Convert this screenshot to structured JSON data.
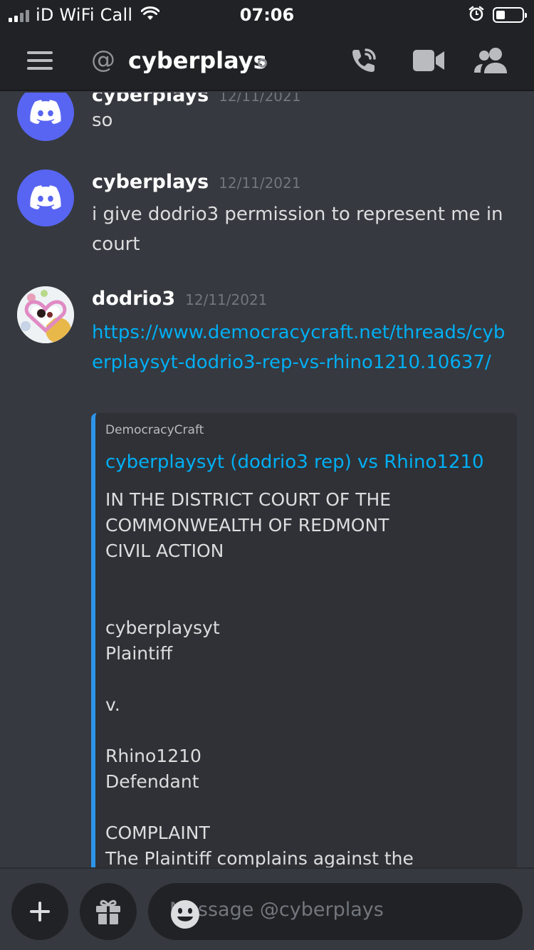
{
  "status_bar": {
    "carrier": "iD WiFi Call",
    "time": "07:06"
  },
  "header": {
    "channel_name": "cyberplays"
  },
  "messages": [
    {
      "username": "cyberplays",
      "timestamp": "12/11/2021",
      "text": "so"
    },
    {
      "username": "cyberplays",
      "timestamp": "12/11/2021",
      "text": "i give dodrio3  permission to represent me in court"
    },
    {
      "username": "dodrio3",
      "timestamp": "12/11/2021",
      "link": "https://www.democracycraft.net/threads/cyberplaysyt-dodrio3-rep-vs-rhino1210.10637/",
      "embed": {
        "provider": "DemocracyCraft",
        "title": "cyberplaysyt (dodrio3 rep) vs Rhino1210",
        "lines": [
          "IN THE DISTRICT COURT OF THE",
          "COMMONWEALTH OF REDMONT",
          "CIVIL ACTION",
          "",
          "",
          "cyberplaysyt",
          "Plaintiff",
          "",
          "v.",
          "",
          "Rhino1210",
          "Defendant",
          "",
          "COMPLAINT",
          "The Plaintiff complains against the Defendant"
        ]
      }
    }
  ],
  "input": {
    "placeholder": "Message @cyberplays"
  },
  "colors": {
    "accent": "#5865f2",
    "link": "#00aff4",
    "embed_bar": "#2e94e8",
    "background": "#36393f"
  }
}
